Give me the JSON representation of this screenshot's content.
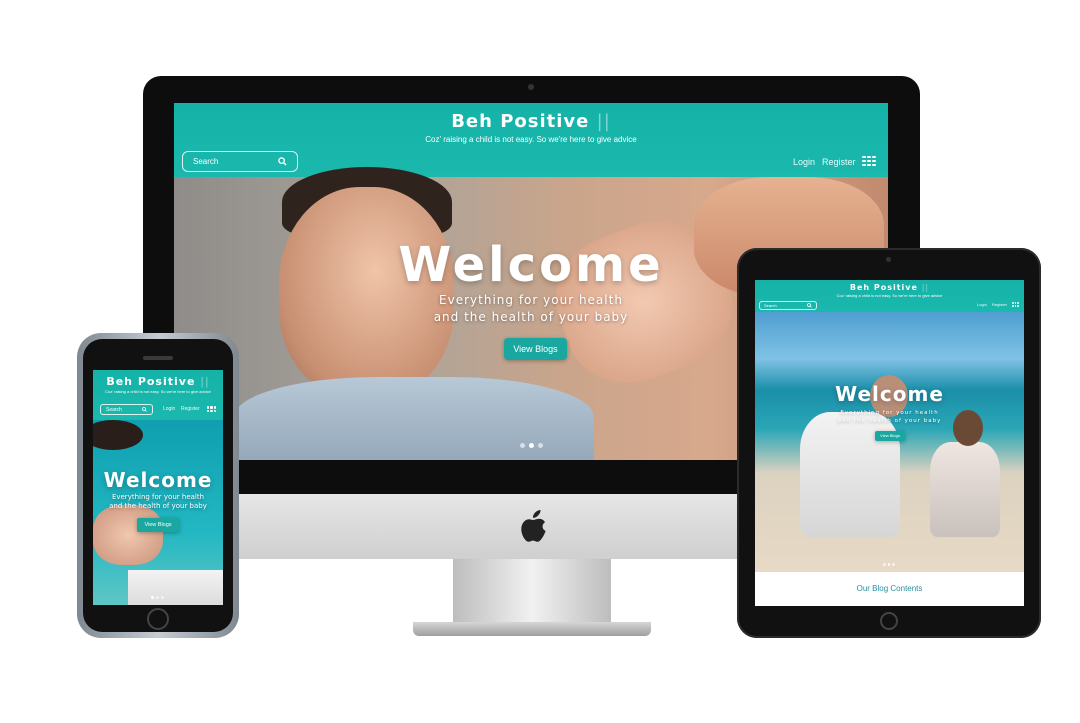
{
  "site": {
    "brand": "Beh Positive",
    "brand_bars": "||",
    "tagline": "Coz' raising a child is not easy. So we're here to give advice",
    "search_placeholder": "Search",
    "nav": {
      "login": "Login",
      "register": "Register"
    },
    "hero": {
      "title": "Welcome",
      "subtitle_line1": "Everything for your health",
      "subtitle_line2": "and the health of your baby",
      "button": "View Blogs"
    },
    "blog_section_title": "Our Blog Contents",
    "accent_color": "#1ab8ad",
    "button_color": "#1aa7a0"
  },
  "devices": {
    "desktop": {
      "icon": "apple-logo-icon"
    },
    "slider_dots_active_index": 1
  }
}
